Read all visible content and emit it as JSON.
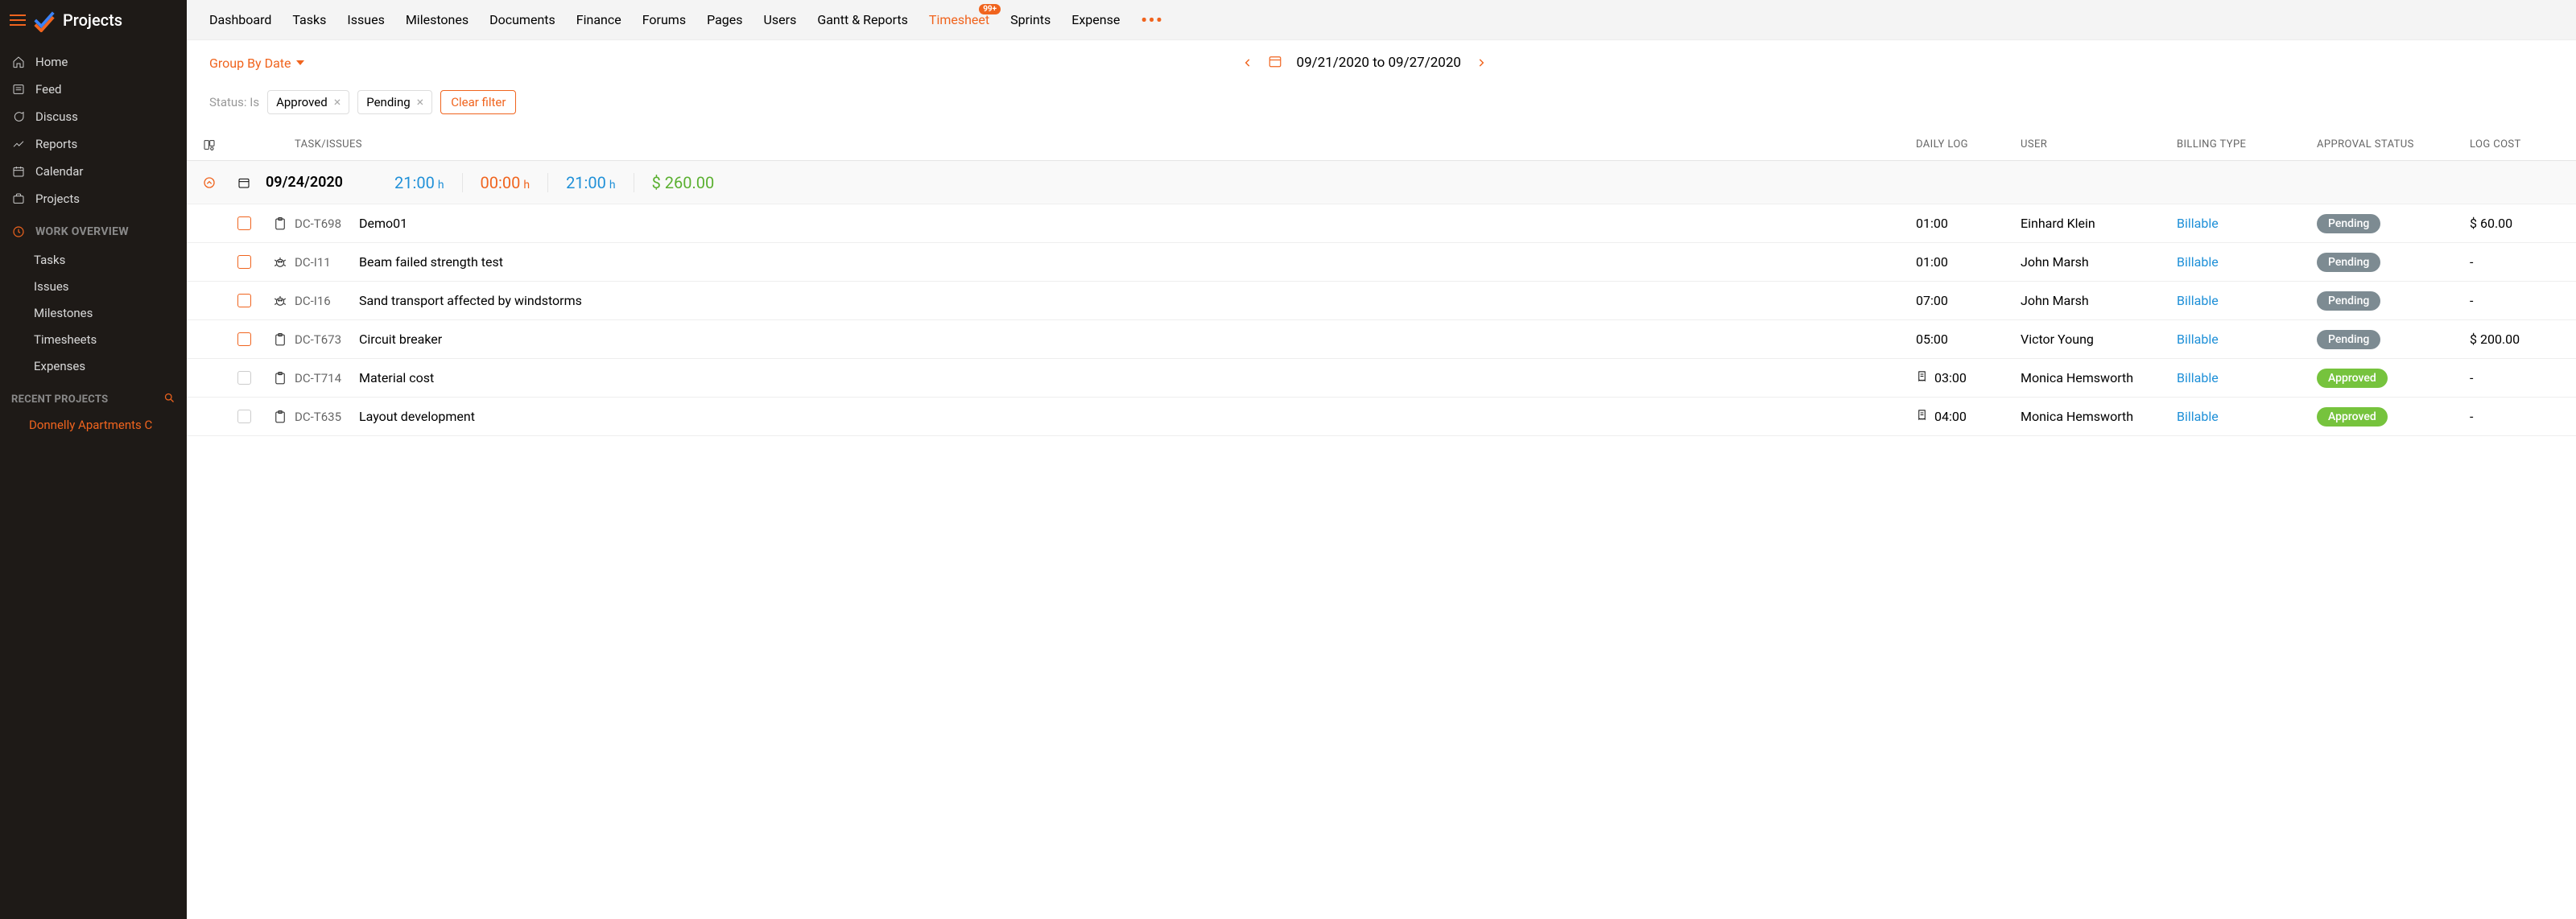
{
  "app": {
    "title": "Projects"
  },
  "sidebar": {
    "items": [
      {
        "label": "Home"
      },
      {
        "label": "Feed"
      },
      {
        "label": "Discuss"
      },
      {
        "label": "Reports"
      },
      {
        "label": "Calendar"
      },
      {
        "label": "Projects"
      }
    ],
    "work_overview_label": "WORK OVERVIEW",
    "work_items": [
      {
        "label": "Tasks"
      },
      {
        "label": "Issues"
      },
      {
        "label": "Milestones"
      },
      {
        "label": "Timesheets"
      },
      {
        "label": "Expenses"
      }
    ],
    "recent_label": "RECENT PROJECTS",
    "recent": [
      {
        "label": "Donnelly Apartments C"
      }
    ]
  },
  "topnav": {
    "tabs": [
      {
        "label": "Dashboard"
      },
      {
        "label": "Tasks"
      },
      {
        "label": "Issues"
      },
      {
        "label": "Milestones"
      },
      {
        "label": "Documents"
      },
      {
        "label": "Finance"
      },
      {
        "label": "Forums"
      },
      {
        "label": "Pages"
      },
      {
        "label": "Users"
      },
      {
        "label": "Gantt & Reports"
      },
      {
        "label": "Timesheet",
        "active": true,
        "badge": "99+"
      },
      {
        "label": "Sprints"
      },
      {
        "label": "Expense"
      }
    ]
  },
  "toolbar": {
    "groupby": "Group By Date",
    "date_range": "09/21/2020 to 09/27/2020"
  },
  "filters": {
    "label": "Status: Is",
    "chips": [
      "Approved",
      "Pending"
    ],
    "clear": "Clear filter"
  },
  "columns": {
    "task": "TASK/ISSUES",
    "dailylog": "DAILY LOG",
    "user": "USER",
    "billing": "BILLING TYPE",
    "approval": "APPROVAL STATUS",
    "logcost": "LOG COST"
  },
  "summary": {
    "date": "09/24/2020",
    "hours_blue": "21:00",
    "hours_orange": "00:00",
    "hours_total": "21:00",
    "unit": "h",
    "cost": "$ 260.00"
  },
  "rows": [
    {
      "type": "task",
      "id": "DC-T698",
      "name": "Demo01",
      "log": "01:00",
      "user": "Einhard Klein",
      "billing": "Billable",
      "approval": "Pending",
      "cost": "$ 60.00",
      "checked_color": "orange"
    },
    {
      "type": "bug",
      "id": "DC-I11",
      "name": "Beam failed strength test",
      "log": "01:00",
      "user": "John Marsh",
      "billing": "Billable",
      "approval": "Pending",
      "cost": "-",
      "checked_color": "orange"
    },
    {
      "type": "bug",
      "id": "DC-I16",
      "name": "Sand transport affected by windstorms",
      "log": "07:00",
      "user": "John Marsh",
      "billing": "Billable",
      "approval": "Pending",
      "cost": "-",
      "checked_color": "orange"
    },
    {
      "type": "task",
      "id": "DC-T673",
      "name": "Circuit breaker",
      "log": "05:00",
      "user": "Victor Young",
      "billing": "Billable",
      "approval": "Pending",
      "cost": "$ 200.00",
      "checked_color": "orange"
    },
    {
      "type": "task",
      "id": "DC-T714",
      "name": "Material cost",
      "log": "03:00",
      "user": "Monica Hemsworth",
      "billing": "Billable",
      "approval": "Approved",
      "cost": "-",
      "checked_color": "gray",
      "receipt": true
    },
    {
      "type": "task",
      "id": "DC-T635",
      "name": "Layout development",
      "log": "04:00",
      "user": "Monica Hemsworth",
      "billing": "Billable",
      "approval": "Approved",
      "cost": "-",
      "checked_color": "gray",
      "receipt": true
    }
  ]
}
